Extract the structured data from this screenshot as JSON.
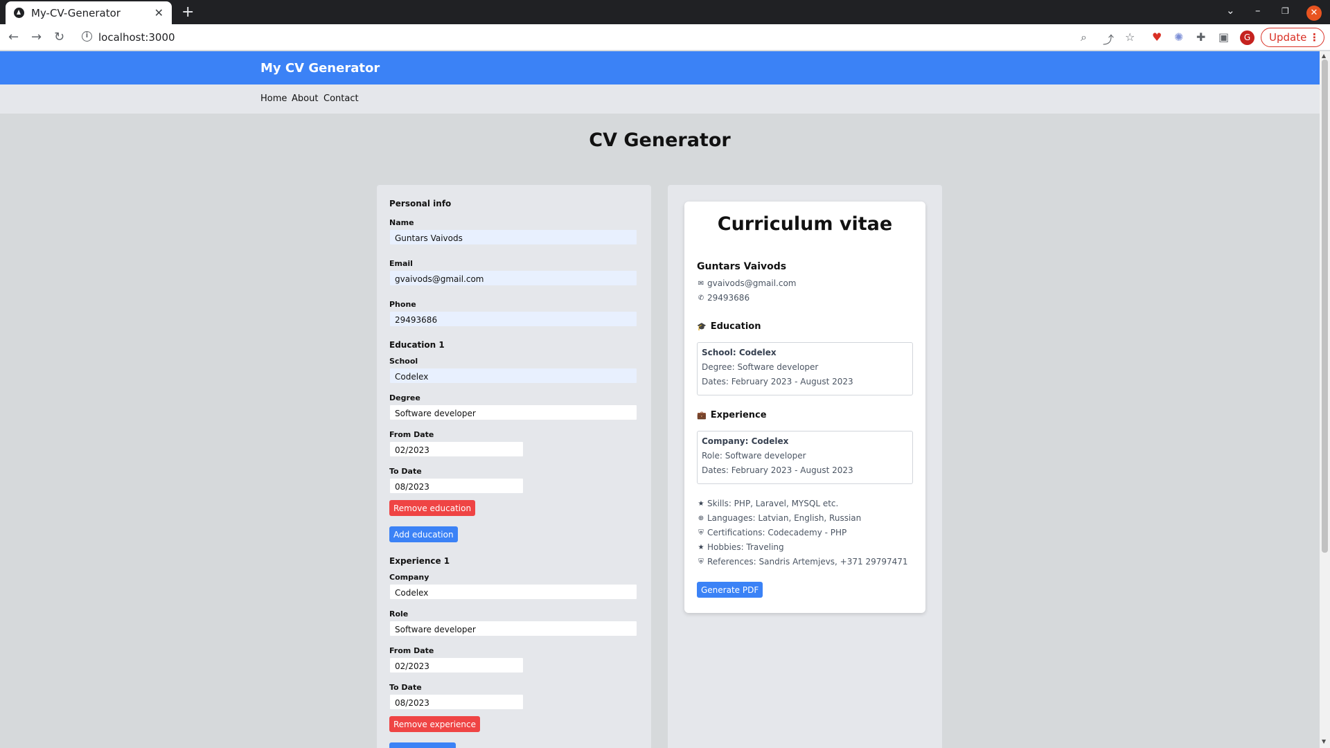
{
  "browser": {
    "tab_title": "My-CV-Generator",
    "url": "localhost:3000",
    "update_label": "Update",
    "avatar_letter": "G"
  },
  "site": {
    "brand": "My CV Generator",
    "nav": [
      "Home",
      "About",
      "Contact"
    ],
    "heading": "CV Generator"
  },
  "form": {
    "personal_heading": "Personal info",
    "name_label": "Name",
    "name_value": "Guntars Vaivods",
    "email_label": "Email",
    "email_value": "gvaivods@gmail.com",
    "phone_label": "Phone",
    "phone_value": "29493686",
    "education": {
      "heading": "Education 1",
      "school_label": "School",
      "school_value": "Codelex",
      "degree_label": "Degree",
      "degree_value": "Software developer",
      "from_label": "From Date",
      "from_value": "02/2023",
      "to_label": "To Date",
      "to_value": "08/2023",
      "remove_label": "Remove education",
      "add_label": "Add education"
    },
    "experience": {
      "heading": "Experience 1",
      "company_label": "Company",
      "company_value": "Codelex",
      "role_label": "Role",
      "role_value": "Software developer",
      "from_label": "From Date",
      "from_value": "02/2023",
      "to_label": "To Date",
      "to_value": "08/2023",
      "remove_label": "Remove experience"
    }
  },
  "cv": {
    "title": "Curriculum vitae",
    "name": "Guntars Vaivods",
    "email": "gvaivods@gmail.com",
    "phone": "29493686",
    "education_heading": "Education",
    "education_school": "School: Codelex",
    "education_degree": "Degree: Software developer",
    "education_dates": "Dates: February 2023 - August 2023",
    "experience_heading": "Experience",
    "experience_company": "Company: Codelex",
    "experience_role": "Role: Software developer",
    "experience_dates": "Dates: February 2023 - August 2023",
    "skills": "Skills: PHP, Laravel, MYSQL etc.",
    "languages": "Languages: Latvian, English, Russian",
    "certifications": "Certifications: Codecademy - PHP",
    "hobbies": "Hobbies: Traveling",
    "references": "References: Sandris Artemjevs, +371 29797471",
    "generate_label": "Generate PDF"
  },
  "colors": {
    "header_blue": "#3b82f6",
    "remove_red": "#ef4444"
  }
}
